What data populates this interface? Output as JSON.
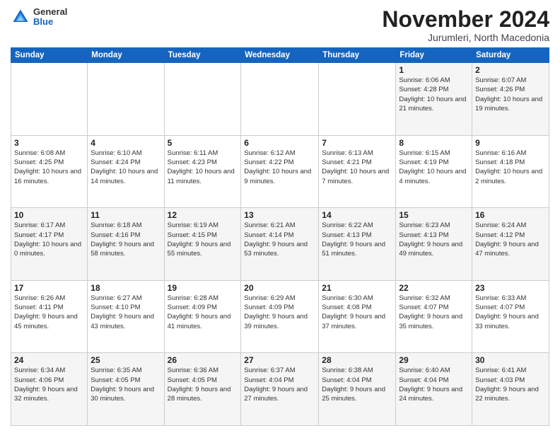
{
  "header": {
    "logo": {
      "general": "General",
      "blue": "Blue"
    },
    "title": "November 2024",
    "subtitle": "Jurumleri, North Macedonia"
  },
  "calendar": {
    "days_of_week": [
      "Sunday",
      "Monday",
      "Tuesday",
      "Wednesday",
      "Thursday",
      "Friday",
      "Saturday"
    ],
    "weeks": [
      [
        {
          "day": "",
          "info": ""
        },
        {
          "day": "",
          "info": ""
        },
        {
          "day": "",
          "info": ""
        },
        {
          "day": "",
          "info": ""
        },
        {
          "day": "",
          "info": ""
        },
        {
          "day": "1",
          "info": "Sunrise: 6:06 AM\nSunset: 4:28 PM\nDaylight: 10 hours and 21 minutes."
        },
        {
          "day": "2",
          "info": "Sunrise: 6:07 AM\nSunset: 4:26 PM\nDaylight: 10 hours and 19 minutes."
        }
      ],
      [
        {
          "day": "3",
          "info": "Sunrise: 6:08 AM\nSunset: 4:25 PM\nDaylight: 10 hours and 16 minutes."
        },
        {
          "day": "4",
          "info": "Sunrise: 6:10 AM\nSunset: 4:24 PM\nDaylight: 10 hours and 14 minutes."
        },
        {
          "day": "5",
          "info": "Sunrise: 6:11 AM\nSunset: 4:23 PM\nDaylight: 10 hours and 11 minutes."
        },
        {
          "day": "6",
          "info": "Sunrise: 6:12 AM\nSunset: 4:22 PM\nDaylight: 10 hours and 9 minutes."
        },
        {
          "day": "7",
          "info": "Sunrise: 6:13 AM\nSunset: 4:21 PM\nDaylight: 10 hours and 7 minutes."
        },
        {
          "day": "8",
          "info": "Sunrise: 6:15 AM\nSunset: 4:19 PM\nDaylight: 10 hours and 4 minutes."
        },
        {
          "day": "9",
          "info": "Sunrise: 6:16 AM\nSunset: 4:18 PM\nDaylight: 10 hours and 2 minutes."
        }
      ],
      [
        {
          "day": "10",
          "info": "Sunrise: 6:17 AM\nSunset: 4:17 PM\nDaylight: 10 hours and 0 minutes."
        },
        {
          "day": "11",
          "info": "Sunrise: 6:18 AM\nSunset: 4:16 PM\nDaylight: 9 hours and 58 minutes."
        },
        {
          "day": "12",
          "info": "Sunrise: 6:19 AM\nSunset: 4:15 PM\nDaylight: 9 hours and 55 minutes."
        },
        {
          "day": "13",
          "info": "Sunrise: 6:21 AM\nSunset: 4:14 PM\nDaylight: 9 hours and 53 minutes."
        },
        {
          "day": "14",
          "info": "Sunrise: 6:22 AM\nSunset: 4:13 PM\nDaylight: 9 hours and 51 minutes."
        },
        {
          "day": "15",
          "info": "Sunrise: 6:23 AM\nSunset: 4:13 PM\nDaylight: 9 hours and 49 minutes."
        },
        {
          "day": "16",
          "info": "Sunrise: 6:24 AM\nSunset: 4:12 PM\nDaylight: 9 hours and 47 minutes."
        }
      ],
      [
        {
          "day": "17",
          "info": "Sunrise: 6:26 AM\nSunset: 4:11 PM\nDaylight: 9 hours and 45 minutes."
        },
        {
          "day": "18",
          "info": "Sunrise: 6:27 AM\nSunset: 4:10 PM\nDaylight: 9 hours and 43 minutes."
        },
        {
          "day": "19",
          "info": "Sunrise: 6:28 AM\nSunset: 4:09 PM\nDaylight: 9 hours and 41 minutes."
        },
        {
          "day": "20",
          "info": "Sunrise: 6:29 AM\nSunset: 4:09 PM\nDaylight: 9 hours and 39 minutes."
        },
        {
          "day": "21",
          "info": "Sunrise: 6:30 AM\nSunset: 4:08 PM\nDaylight: 9 hours and 37 minutes."
        },
        {
          "day": "22",
          "info": "Sunrise: 6:32 AM\nSunset: 4:07 PM\nDaylight: 9 hours and 35 minutes."
        },
        {
          "day": "23",
          "info": "Sunrise: 6:33 AM\nSunset: 4:07 PM\nDaylight: 9 hours and 33 minutes."
        }
      ],
      [
        {
          "day": "24",
          "info": "Sunrise: 6:34 AM\nSunset: 4:06 PM\nDaylight: 9 hours and 32 minutes."
        },
        {
          "day": "25",
          "info": "Sunrise: 6:35 AM\nSunset: 4:05 PM\nDaylight: 9 hours and 30 minutes."
        },
        {
          "day": "26",
          "info": "Sunrise: 6:36 AM\nSunset: 4:05 PM\nDaylight: 9 hours and 28 minutes."
        },
        {
          "day": "27",
          "info": "Sunrise: 6:37 AM\nSunset: 4:04 PM\nDaylight: 9 hours and 27 minutes."
        },
        {
          "day": "28",
          "info": "Sunrise: 6:38 AM\nSunset: 4:04 PM\nDaylight: 9 hours and 25 minutes."
        },
        {
          "day": "29",
          "info": "Sunrise: 6:40 AM\nSunset: 4:04 PM\nDaylight: 9 hours and 24 minutes."
        },
        {
          "day": "30",
          "info": "Sunrise: 6:41 AM\nSunset: 4:03 PM\nDaylight: 9 hours and 22 minutes."
        }
      ]
    ]
  }
}
